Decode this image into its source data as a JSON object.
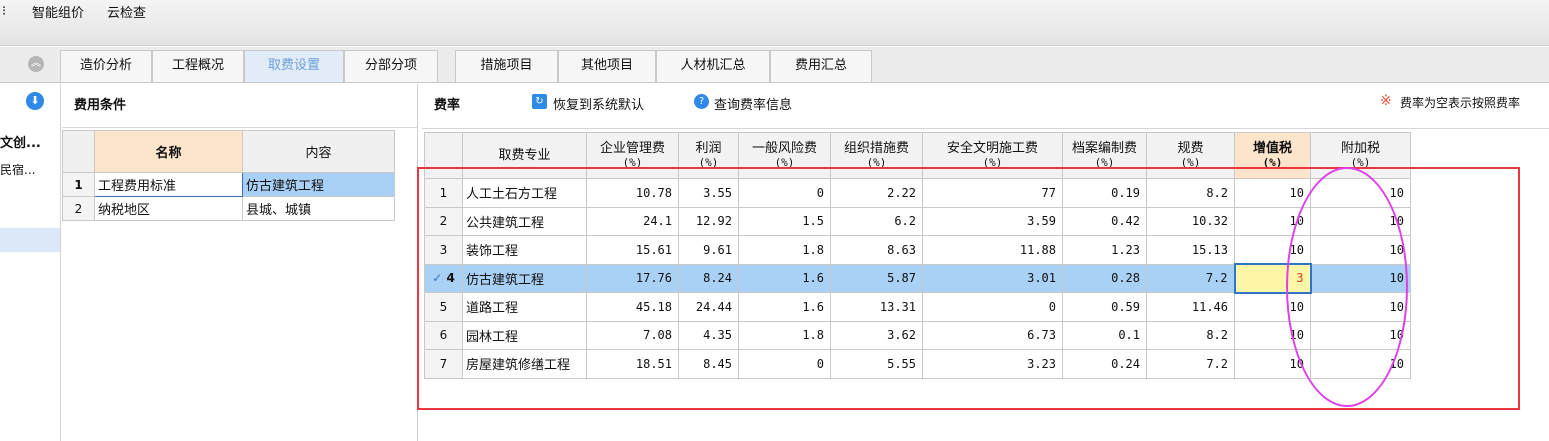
{
  "menu": {
    "bullet": "⁝",
    "items": [
      "智能组价",
      "云检查"
    ]
  },
  "tabs": [
    {
      "label": "造价分析",
      "active": false
    },
    {
      "label": "工程概况",
      "active": false
    },
    {
      "label": "取费设置",
      "active": true
    },
    {
      "label": "分部分项",
      "active": false
    },
    {
      "label": "措施项目",
      "active": false
    },
    {
      "label": "其他项目",
      "active": false
    },
    {
      "label": "人材机汇总",
      "active": false
    },
    {
      "label": "费用汇总",
      "active": false
    }
  ],
  "left_nav": {
    "item1": "文创...",
    "item2": "民宿..."
  },
  "conditions": {
    "title": "费用条件",
    "headers": {
      "name": "名称",
      "content": "内容"
    },
    "rows": [
      {
        "num": "1",
        "name": "工程费用标准",
        "content": "仿古建筑工程"
      },
      {
        "num": "2",
        "name": "纳税地区",
        "content": "县城、城镇"
      }
    ]
  },
  "rates": {
    "title": "费率",
    "restore_label": "恢复到系统默认",
    "query_label": "查询费率信息",
    "note_icon": "※",
    "note_text": "费率为空表示按照费率",
    "unit": "(%)",
    "headers": [
      "取费专业",
      "企业管理费",
      "利润",
      "一般风险费",
      "组织措施费",
      "安全文明施工费",
      "档案编制费",
      "规费",
      "增值税",
      "附加税"
    ],
    "rows": [
      {
        "num": "1",
        "name": "人工土石方工程",
        "values": [
          "10.78",
          "3.55",
          "0",
          "2.22",
          "77",
          "0.19",
          "8.2",
          "10",
          "10"
        ]
      },
      {
        "num": "2",
        "name": "公共建筑工程",
        "values": [
          "24.1",
          "12.92",
          "1.5",
          "6.2",
          "3.59",
          "0.42",
          "10.32",
          "10",
          "10"
        ]
      },
      {
        "num": "3",
        "name": "装饰工程",
        "values": [
          "15.61",
          "9.61",
          "1.8",
          "8.63",
          "11.88",
          "1.23",
          "15.13",
          "10",
          "10"
        ]
      },
      {
        "num": "4",
        "name": "仿古建筑工程",
        "values": [
          "17.76",
          "8.24",
          "1.6",
          "5.87",
          "3.01",
          "0.28",
          "7.2",
          "3",
          "10"
        ],
        "selected": true
      },
      {
        "num": "5",
        "name": "道路工程",
        "values": [
          "45.18",
          "24.44",
          "1.6",
          "13.31",
          "0",
          "0.59",
          "11.46",
          "10",
          "10"
        ]
      },
      {
        "num": "6",
        "name": "园林工程",
        "values": [
          "7.08",
          "4.35",
          "1.8",
          "3.62",
          "6.73",
          "0.1",
          "8.2",
          "10",
          "10"
        ]
      },
      {
        "num": "7",
        "name": "房屋建筑修缮工程",
        "values": [
          "18.51",
          "8.45",
          "0",
          "5.55",
          "3.23",
          "0.24",
          "7.2",
          "10",
          "10"
        ]
      }
    ],
    "check_mark": "✓"
  },
  "colors": {
    "accent": "#2e8ae6",
    "selected_row": "#a9d0f5",
    "highlight_header": "#fde5cc",
    "annotation_red": "#e8353f",
    "annotation_magenta": "#e040e8"
  }
}
